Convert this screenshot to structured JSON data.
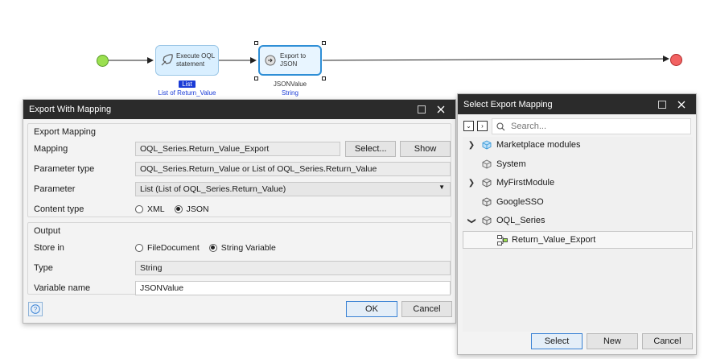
{
  "flow": {
    "activity1": {
      "label_line1": "Execute OQL",
      "label_line2": "statement",
      "output_badge": "List",
      "output_var": "List of Return_Value"
    },
    "activity2": {
      "label": "Export to JSON",
      "output_var": "JSONValue",
      "output_type": "String"
    }
  },
  "export_dialog": {
    "title": "Export With Mapping",
    "section_mapping": "Export Mapping",
    "mapping_label": "Mapping",
    "mapping_value": "OQL_Series.Return_Value_Export",
    "select_button": "Select...",
    "show_button": "Show",
    "param_type_label": "Parameter type",
    "param_type_value": "OQL_Series.Return_Value or List of OQL_Series.Return_Value",
    "parameter_label": "Parameter",
    "parameter_value": "List (List of OQL_Series.Return_Value)",
    "content_type_label": "Content type",
    "content_type_options": [
      "XML",
      "JSON"
    ],
    "content_type_selected": "JSON",
    "section_output": "Output",
    "store_in_label": "Store in",
    "store_in_options": [
      "FileDocument",
      "String Variable"
    ],
    "store_in_selected": "String Variable",
    "type_label": "Type",
    "type_value": "String",
    "varname_label": "Variable name",
    "varname_value": "JSONValue",
    "ok_button": "OK",
    "cancel_button": "Cancel"
  },
  "select_dialog": {
    "title": "Select Export Mapping",
    "search_placeholder": "Search...",
    "tree": [
      {
        "label": "Marketplace modules",
        "expand": "collapsed"
      },
      {
        "label": "System",
        "expand": "none"
      },
      {
        "label": "MyFirstModule",
        "expand": "collapsed"
      },
      {
        "label": "GoogleSSO",
        "expand": "none"
      },
      {
        "label": "OQL_Series",
        "expand": "expanded"
      },
      {
        "label": "Return_Value_Export",
        "expand": "leaf"
      }
    ],
    "select_button": "Select",
    "new_button": "New",
    "cancel_button": "Cancel"
  },
  "colors": {
    "accent": "#2f8fd6",
    "titlebar": "#2b2b2b",
    "start": "#9be050",
    "end": "#f26262",
    "list_badge": "#1a3bd6"
  }
}
